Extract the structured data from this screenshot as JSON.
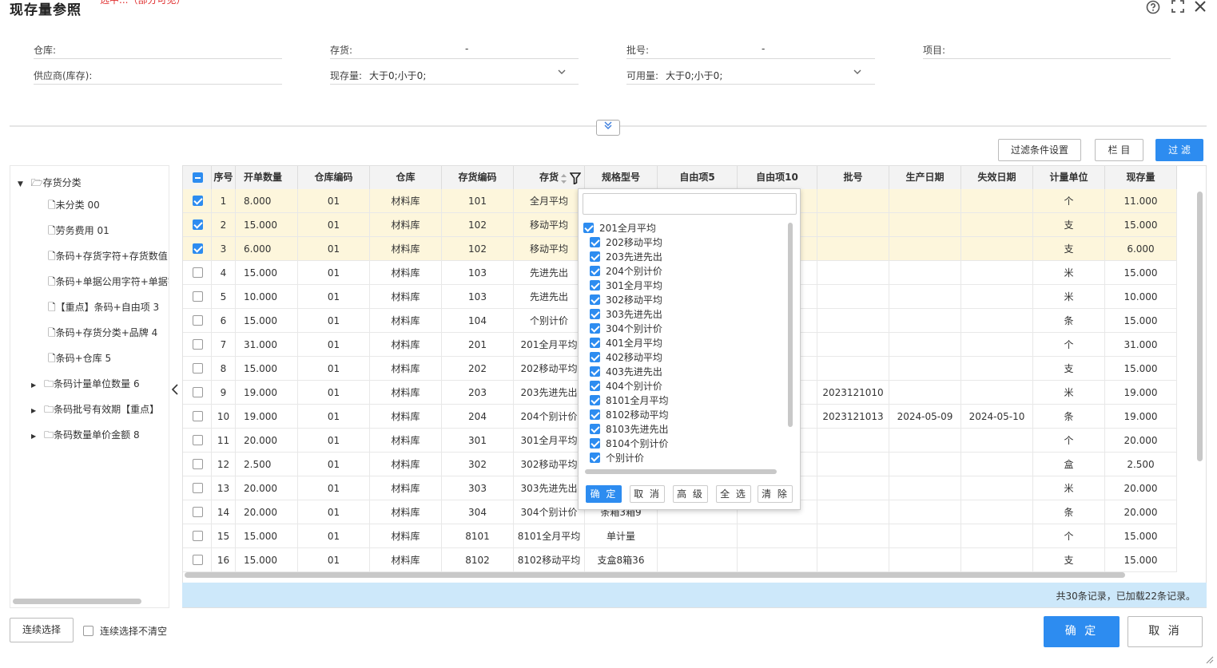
{
  "window": {
    "title": "现存量参照",
    "red_note": "选中...（部分可见）"
  },
  "filters": {
    "warehouse_label": "仓库:",
    "inventory_label": "存货:",
    "inventory_value": "-",
    "batch_label": "批号:",
    "batch_value": "-",
    "project_label": "项目:",
    "supplier_label": "供应商(库存):",
    "onhand_label": "现存量:",
    "onhand_value": "大于0;小于0;",
    "available_label": "可用量:",
    "available_value": "大于0;小于0;"
  },
  "toolbar": {
    "filter_settings": "过滤条件设置",
    "columns": "栏 目",
    "filter": "过 滤"
  },
  "tree": {
    "root": "存货分类",
    "items": [
      "未分类 00",
      "劳务费用 01",
      "条码+存货字符+存货数值",
      "条码+单据公用字符+单据字",
      "【重点】条码+自由项 3",
      "条码+存货分类+品牌 4",
      "条码+仓库 5",
      "条码计量单位数量 6",
      "条码批号有效期【重点】",
      "条码数量单价金额 8"
    ]
  },
  "columns": [
    "序号",
    "开单数量",
    "仓库编码",
    "仓库",
    "存货编码",
    "存货",
    "规格型号",
    "自由项5",
    "自由项10",
    "批号",
    "生产日期",
    "失效日期",
    "计量单位",
    "现存量"
  ],
  "rows": [
    {
      "no": "1",
      "qty": "8.000",
      "wcode": "01",
      "wh": "材料库",
      "icode": "101",
      "inv": "全月平均",
      "spec": "",
      "f5": "",
      "f10": "",
      "batch": "",
      "mdate": "",
      "edate": "",
      "unit": "个",
      "stock": "11.000",
      "sel": true
    },
    {
      "no": "2",
      "qty": "15.000",
      "wcode": "01",
      "wh": "材料库",
      "icode": "102",
      "inv": "移动平均",
      "spec": "",
      "f5": "",
      "f10": "",
      "batch": "",
      "mdate": "",
      "edate": "",
      "unit": "支",
      "stock": "15.000",
      "sel": true
    },
    {
      "no": "3",
      "qty": "6.000",
      "wcode": "01",
      "wh": "材料库",
      "icode": "102",
      "inv": "移动平均",
      "spec": "",
      "f5": "",
      "f10": "",
      "batch": "",
      "mdate": "",
      "edate": "",
      "unit": "支",
      "stock": "6.000",
      "sel": true
    },
    {
      "no": "4",
      "qty": "15.000",
      "wcode": "01",
      "wh": "材料库",
      "icode": "103",
      "inv": "先进先出",
      "spec": "",
      "f5": "",
      "f10": "",
      "batch": "",
      "mdate": "",
      "edate": "",
      "unit": "米",
      "stock": "15.000",
      "sel": false
    },
    {
      "no": "5",
      "qty": "10.000",
      "wcode": "01",
      "wh": "材料库",
      "icode": "103",
      "inv": "先进先出",
      "spec": "",
      "f5": "",
      "f10": "",
      "batch": "",
      "mdate": "",
      "edate": "",
      "unit": "米",
      "stock": "10.000",
      "sel": false
    },
    {
      "no": "6",
      "qty": "15.000",
      "wcode": "01",
      "wh": "材料库",
      "icode": "104",
      "inv": "个别计价",
      "spec": "",
      "f5": "",
      "f10": "",
      "batch": "",
      "mdate": "",
      "edate": "",
      "unit": "条",
      "stock": "15.000",
      "sel": false
    },
    {
      "no": "7",
      "qty": "31.000",
      "wcode": "01",
      "wh": "材料库",
      "icode": "201",
      "inv": "201全月平均",
      "spec": "",
      "f5": "",
      "f10": "",
      "batch": "",
      "mdate": "",
      "edate": "",
      "unit": "个",
      "stock": "31.000",
      "sel": false
    },
    {
      "no": "8",
      "qty": "15.000",
      "wcode": "01",
      "wh": "材料库",
      "icode": "202",
      "inv": "202移动平均",
      "spec": "",
      "f5": "",
      "f10": "",
      "batch": "",
      "mdate": "",
      "edate": "",
      "unit": "支",
      "stock": "15.000",
      "sel": false
    },
    {
      "no": "9",
      "qty": "19.000",
      "wcode": "01",
      "wh": "材料库",
      "icode": "203",
      "inv": "203先进先出",
      "spec": "",
      "f5": "",
      "f10": "",
      "batch": "2023121010",
      "mdate": "",
      "edate": "",
      "unit": "米",
      "stock": "19.000",
      "sel": false
    },
    {
      "no": "10",
      "qty": "19.000",
      "wcode": "01",
      "wh": "材料库",
      "icode": "204",
      "inv": "204个别计价",
      "spec": "",
      "f5": "",
      "f10": "",
      "batch": "2023121013",
      "mdate": "2024-05-09",
      "edate": "2024-05-10",
      "unit": "条",
      "stock": "19.000",
      "sel": false
    },
    {
      "no": "11",
      "qty": "20.000",
      "wcode": "01",
      "wh": "材料库",
      "icode": "301",
      "inv": "301全月平均",
      "spec": "",
      "f5": "",
      "f10": "",
      "batch": "",
      "mdate": "",
      "edate": "",
      "unit": "个",
      "stock": "20.000",
      "sel": false
    },
    {
      "no": "12",
      "qty": "2.500",
      "wcode": "01",
      "wh": "材料库",
      "icode": "302",
      "inv": "302移动平均",
      "spec": "",
      "f5": "",
      "f10": "",
      "batch": "",
      "mdate": "",
      "edate": "",
      "unit": "盒",
      "stock": "2.500",
      "sel": false
    },
    {
      "no": "13",
      "qty": "20.000",
      "wcode": "01",
      "wh": "材料库",
      "icode": "303",
      "inv": "303先进先出",
      "spec": "",
      "f5": "",
      "f10": "",
      "batch": "",
      "mdate": "",
      "edate": "",
      "unit": "米",
      "stock": "20.000",
      "sel": false
    },
    {
      "no": "14",
      "qty": "20.000",
      "wcode": "01",
      "wh": "材料库",
      "icode": "304",
      "inv": "304个别计价",
      "spec": "条箱3箱9",
      "f5": "",
      "f10": "",
      "batch": "",
      "mdate": "",
      "edate": "",
      "unit": "条",
      "stock": "20.000",
      "sel": false
    },
    {
      "no": "15",
      "qty": "15.000",
      "wcode": "01",
      "wh": "材料库",
      "icode": "8101",
      "inv": "8101全月平均",
      "spec": "单计量",
      "f5": "",
      "f10": "",
      "batch": "",
      "mdate": "",
      "edate": "",
      "unit": "个",
      "stock": "15.000",
      "sel": false
    },
    {
      "no": "16",
      "qty": "15.000",
      "wcode": "01",
      "wh": "材料库",
      "icode": "8102",
      "inv": "8102移动平均",
      "spec": "支盒8箱36",
      "f5": "",
      "f10": "",
      "batch": "",
      "mdate": "",
      "edate": "",
      "unit": "支",
      "stock": "15.000",
      "sel": false
    }
  ],
  "popup": {
    "options": [
      "201全月平均",
      "202移动平均",
      "203先进先出",
      "204个别计价",
      "301全月平均",
      "302移动平均",
      "303先进先出",
      "304个别计价",
      "401全月平均",
      "402移动平均",
      "403先进先出",
      "404个别计价",
      "8101全月平均",
      "8102移动平均",
      "8103先进先出",
      "8104个别计价",
      "个别计价"
    ],
    "buttons": {
      "ok": "确 定",
      "cancel": "取 消",
      "advanced": "高 级",
      "select_all": "全 选",
      "clear": "清 除"
    }
  },
  "status": {
    "records": "共30条记录，已加载22条记录。"
  },
  "bottom": {
    "continuous_select": "连续选择",
    "keep_selection": "连续选择不清空",
    "ok": "确 定",
    "cancel": "取 消"
  },
  "colors": {
    "primary": "#2d8cf0",
    "selected_row": "#fdf6dc",
    "status_bar": "#cde8fa"
  }
}
